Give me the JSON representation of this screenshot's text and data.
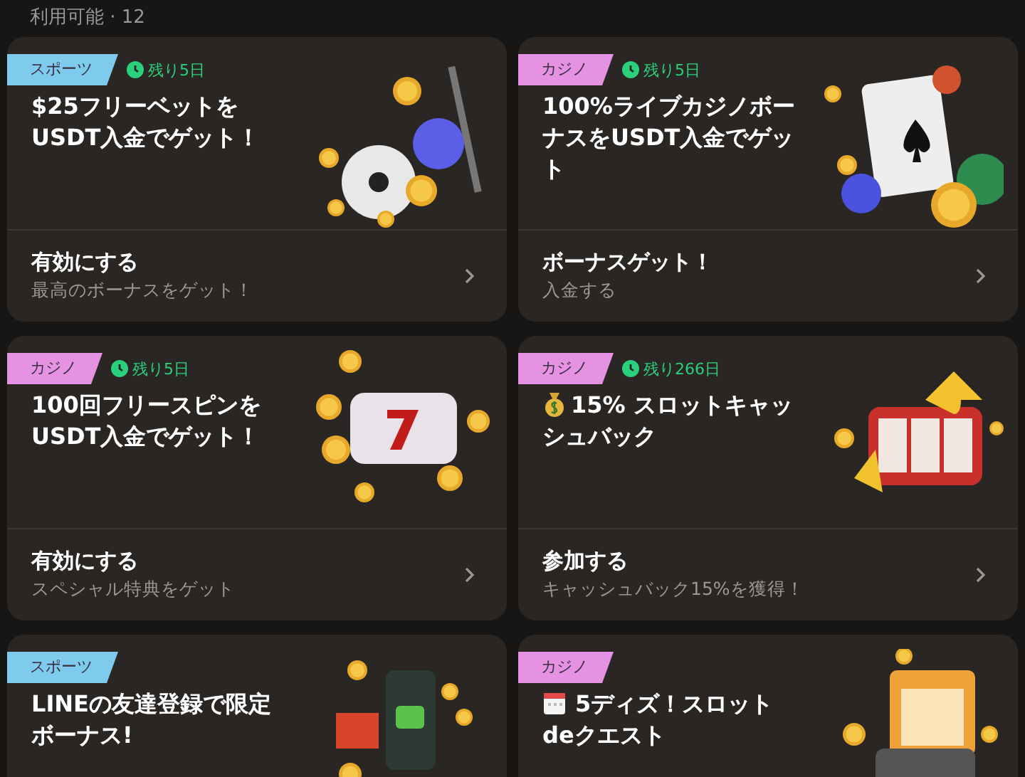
{
  "header": {
    "label": "利用可能 · 12"
  },
  "promotions": [
    {
      "tag": {
        "label": "スポーツ",
        "color": "#7ecbee"
      },
      "timer": "残り5日",
      "title": "$25フリーベットをUSDT入金でゲット！",
      "art": {
        "kind": "sports"
      },
      "action": {
        "label": "有効にする",
        "sub": "最高のボーナスをゲット！"
      }
    },
    {
      "tag": {
        "label": "カジノ",
        "color": "#e592e2"
      },
      "timer": "残り5日",
      "title": "100%ライブカジノボーナスをUSDT入金でゲット",
      "art": {
        "kind": "cards"
      },
      "action": {
        "label": "ボーナスゲット！",
        "sub": "入金する"
      }
    },
    {
      "tag": {
        "label": "カジノ",
        "color": "#e592e2"
      },
      "timer": "残り5日",
      "title": "100回フリースピンをUSDT入金でゲット！",
      "art": {
        "kind": "slot"
      },
      "action": {
        "label": "有効にする",
        "sub": "スペシャル特典をゲット"
      }
    },
    {
      "tag": {
        "label": "カジノ",
        "color": "#e592e2"
      },
      "timer": "残り266日",
      "title_icon": {
        "kind": "money-bag"
      },
      "title": "15% スロットキャッシュバック",
      "art": {
        "kind": "cashback"
      },
      "action": {
        "label": "参加する",
        "sub": "キャッシュバック15%を獲得！"
      }
    },
    {
      "tag": {
        "label": "スポーツ",
        "color": "#7ecbee"
      },
      "title": "LINEの友達登録で限定ボーナス!",
      "art": {
        "kind": "phone"
      }
    },
    {
      "tag": {
        "label": "カジノ",
        "color": "#e592e2"
      },
      "title_icon": {
        "kind": "calendar"
      },
      "title": "5ディズ！スロットdeクエスト",
      "art": {
        "kind": "calendar"
      }
    }
  ]
}
